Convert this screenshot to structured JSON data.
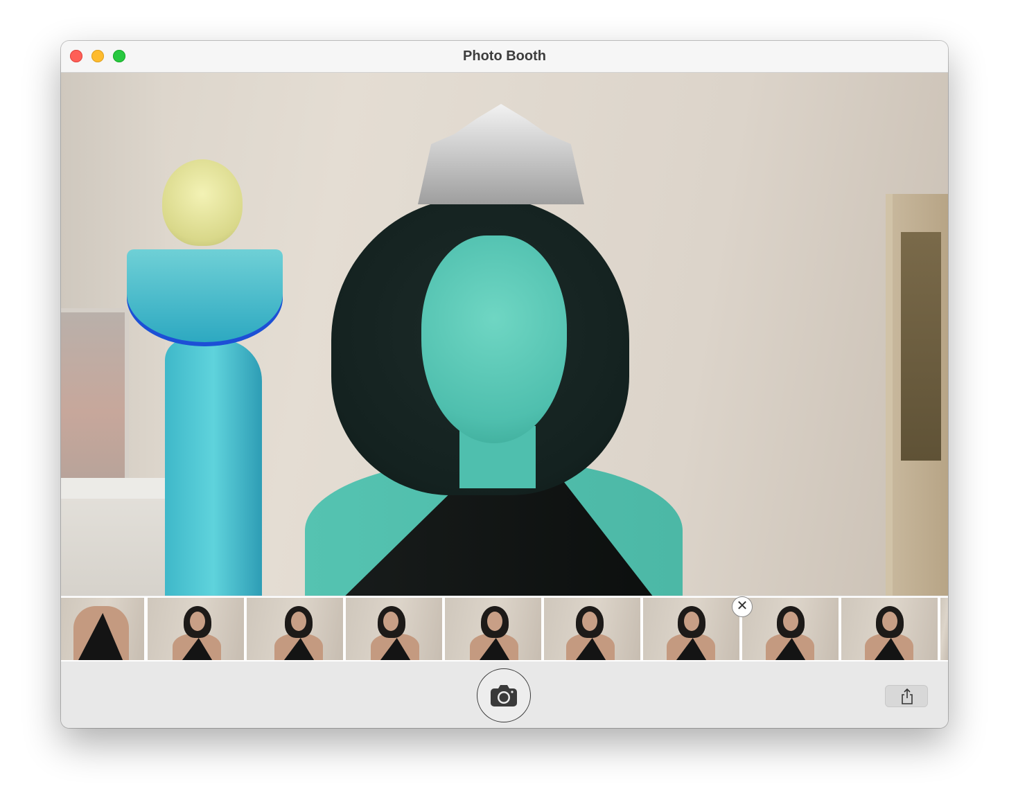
{
  "window": {
    "title": "Photo Booth"
  },
  "preview": {
    "effect": "statue-of-liberty"
  },
  "filmstrip": {
    "thumbnails_count": 10,
    "selected_index": 7
  },
  "toolbar": {
    "shutter_icon": "camera-icon",
    "share_icon": "share-icon"
  },
  "colors": {
    "accent": "#2b78f2",
    "close": "#fe5f57",
    "minimize": "#febb2e",
    "maximize": "#28c840"
  }
}
